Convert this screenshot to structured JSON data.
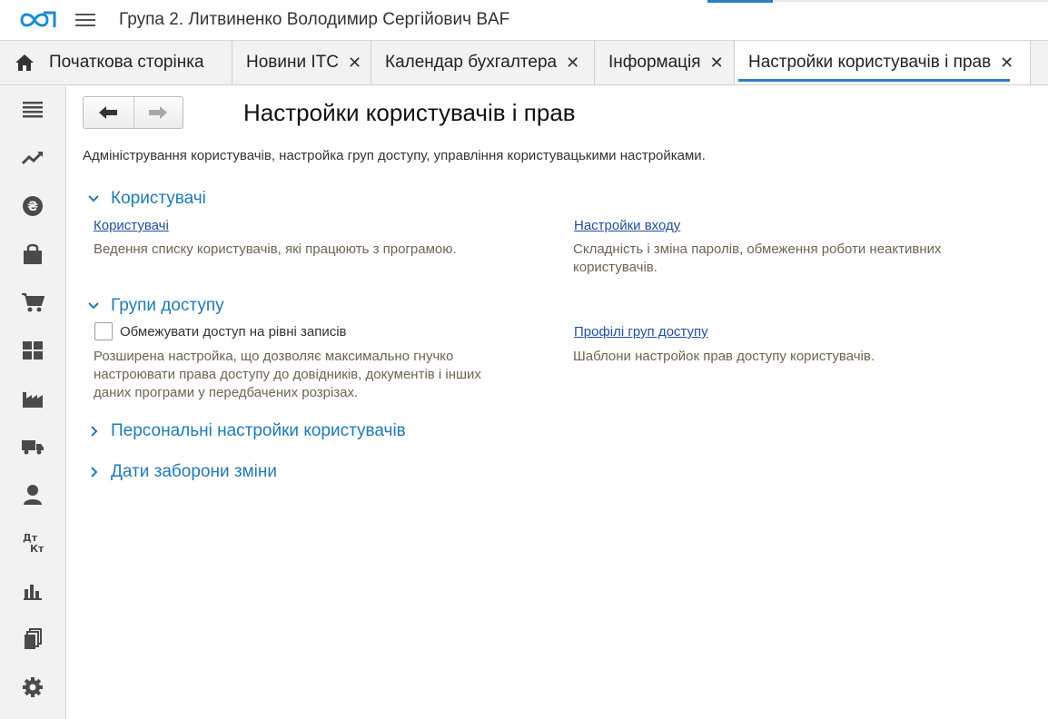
{
  "app": {
    "title": "Група 2. Литвиненко Володимир Сергійович BAF"
  },
  "tabs": [
    {
      "label": "Початкова сторінка",
      "icon": "home-icon",
      "closable": false,
      "active": false
    },
    {
      "label": "Новини ІТС",
      "closable": true,
      "active": false
    },
    {
      "label": "Календар бухгалтера",
      "closable": true,
      "active": false
    },
    {
      "label": "Інформація",
      "closable": true,
      "active": false
    },
    {
      "label": "Настройки користувачів і прав",
      "closable": true,
      "active": true
    }
  ],
  "close_glyph": "✕",
  "sidebar": {
    "items": [
      {
        "icon": "menu-list-icon"
      },
      {
        "icon": "trend-chart-icon"
      },
      {
        "icon": "currency-icon"
      },
      {
        "icon": "shopping-bag-icon"
      },
      {
        "icon": "cart-icon"
      },
      {
        "icon": "warehouse-grid-icon"
      },
      {
        "icon": "factory-icon"
      },
      {
        "icon": "truck-icon"
      },
      {
        "icon": "person-icon"
      },
      {
        "icon": "debit-credit-icon",
        "text_top": "Дт",
        "text_bottom": "Кт"
      },
      {
        "icon": "bar-chart-icon"
      },
      {
        "icon": "documents-icon"
      },
      {
        "icon": "gear-icon"
      }
    ]
  },
  "page": {
    "title": "Настройки користувачів і прав",
    "description": "Адміністрування користувачів, настройка груп доступу, управління користувацькими настройками.",
    "sections": {
      "users": {
        "title": "Користувачі",
        "expanded": true,
        "users_link": "Користувачі",
        "users_note": "Ведення списку користувачів, які працюють з програмою.",
        "login_link": "Настройки входу",
        "login_note_1": "Складність і зміна паролів, обмеження роботи неактивних",
        "login_note_2": "користувачів."
      },
      "access_groups": {
        "title": "Групи доступу",
        "expanded": true,
        "checkbox_label": "Обмежувати доступ на рівні записів",
        "checkbox_checked": false,
        "checkbox_note_1": "Розширена настройка, що дозволяє максимально гнучко",
        "checkbox_note_2": "настроювати права доступу до довідників, документів і інших",
        "checkbox_note_3": "даних програми у передбачених розрізах.",
        "profiles_link": "Профілі груп доступу",
        "profiles_note": "Шаблони настройок прав доступу користувачів."
      },
      "personal": {
        "title": "Персональні настройки користувачів",
        "expanded": false
      },
      "dates": {
        "title": "Дати заборони зміни",
        "expanded": false
      }
    }
  },
  "colors": {
    "accent": "#2b7fc9",
    "section_title": "#1e7ab8",
    "link": "#224f9c",
    "note": "#6f6450",
    "sidebar_icon": "#4a4a4a"
  }
}
